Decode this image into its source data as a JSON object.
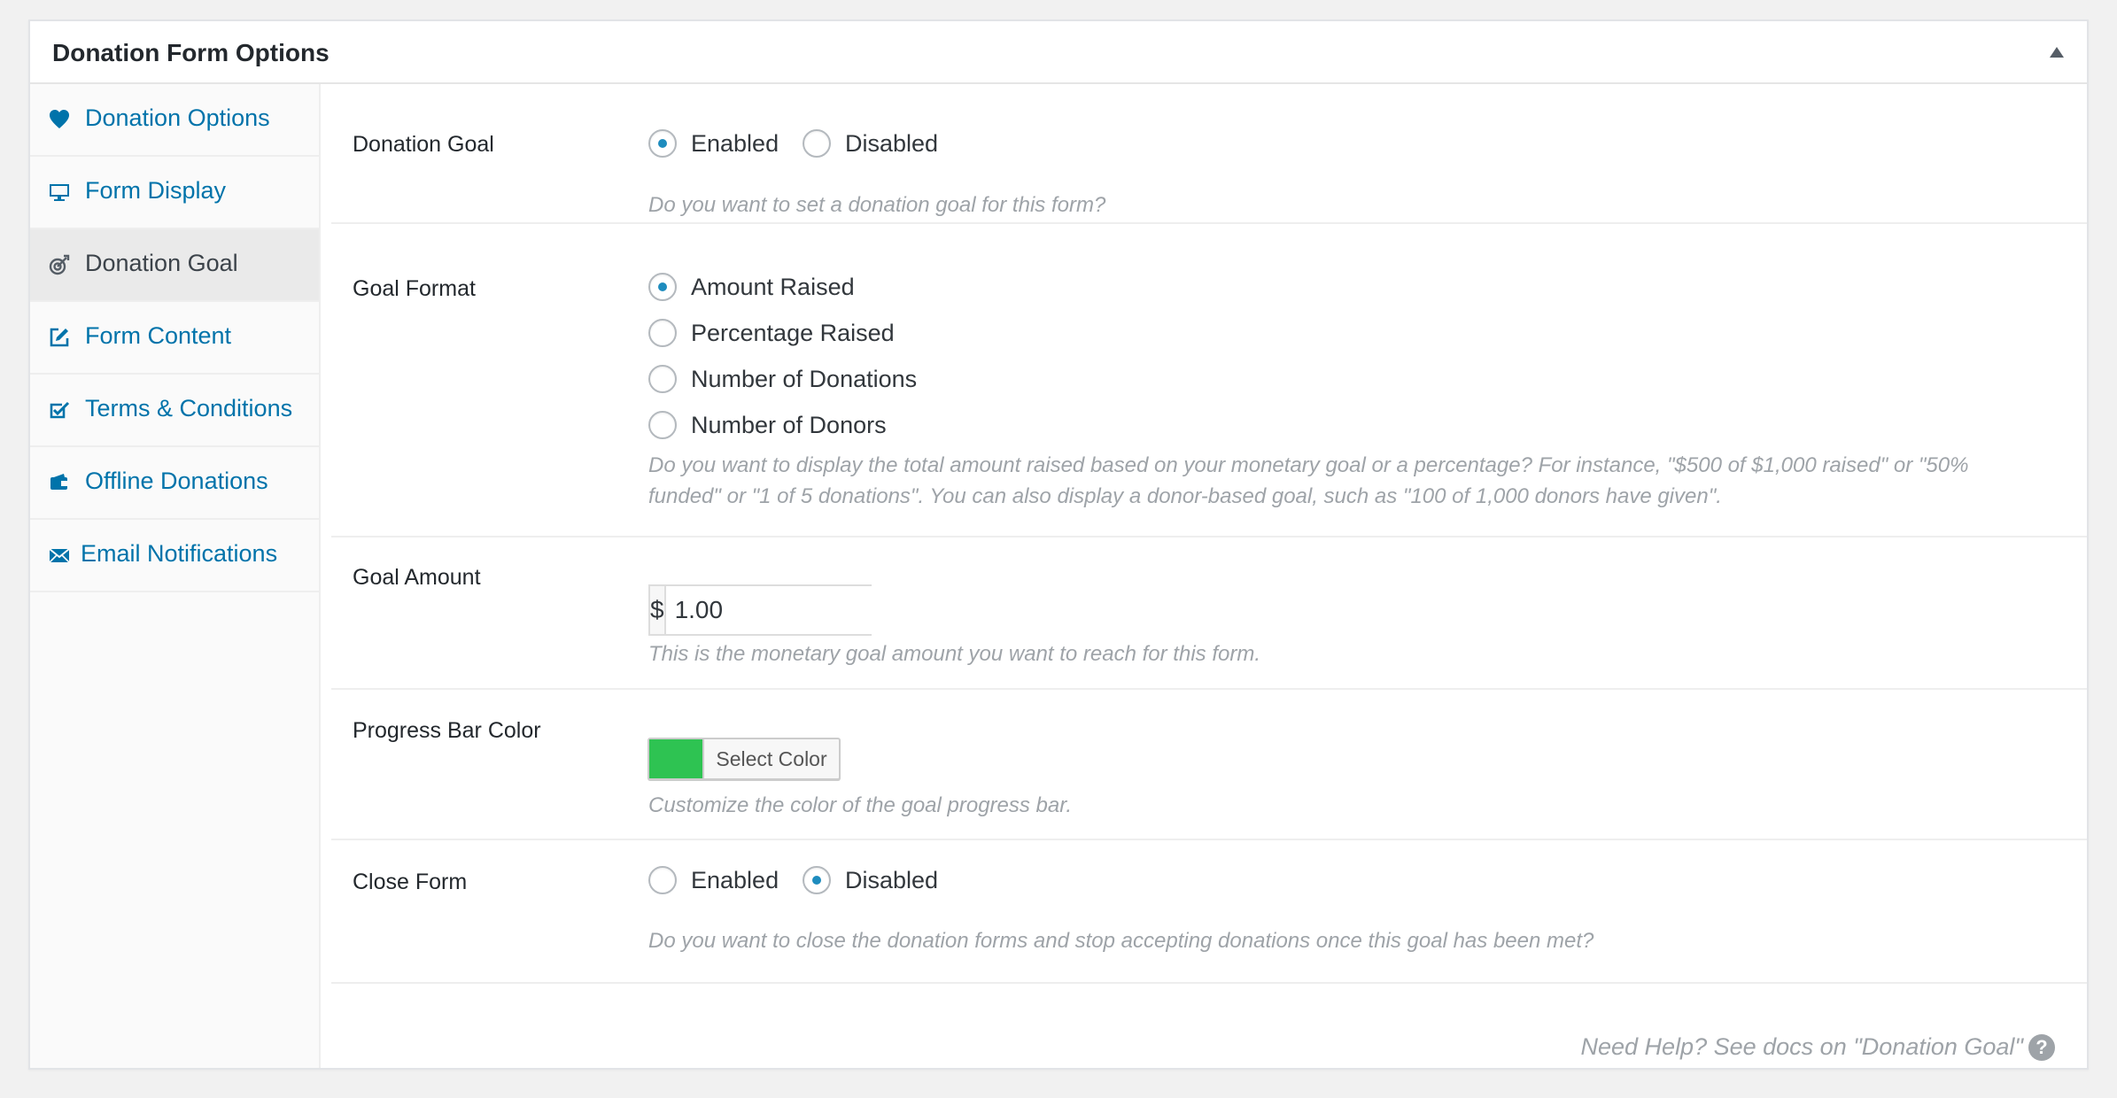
{
  "panel": {
    "title": "Donation Form Options"
  },
  "sidebar": {
    "items": [
      {
        "label": "Donation Options",
        "icon": "heart-icon"
      },
      {
        "label": "Form Display",
        "icon": "monitor-icon"
      },
      {
        "label": "Donation Goal",
        "icon": "target-icon",
        "active": true
      },
      {
        "label": "Form Content",
        "icon": "edit-icon"
      },
      {
        "label": "Terms & Conditions",
        "icon": "checkbox-icon"
      },
      {
        "label": "Offline Donations",
        "icon": "wallet-icon"
      },
      {
        "label": "Email Notifications",
        "icon": "envelope-icon"
      }
    ]
  },
  "fields": {
    "donation_goal": {
      "label": "Donation Goal",
      "options": [
        "Enabled",
        "Disabled"
      ],
      "selected": "Enabled",
      "description": "Do you want to set a donation goal for this form?"
    },
    "goal_format": {
      "label": "Goal Format",
      "options": [
        "Amount Raised",
        "Percentage Raised",
        "Number of Donations",
        "Number of Donors"
      ],
      "selected": "Amount Raised",
      "description_line1": "Do you want to display the total amount raised based on your monetary goal or a percentage? For instance, \"$500 of $1,000 raised\" or \"50%",
      "description_line2": "funded\" or \"1 of 5 donations\". You can also display a donor-based goal, such as \"100 of 1,000 donors have given\"."
    },
    "goal_amount": {
      "label": "Goal Amount",
      "currency": "$",
      "value": "1.00",
      "description": "This is the monetary goal amount you want to reach for this form."
    },
    "progress_bar_color": {
      "label": "Progress Bar Color",
      "button_label": "Select Color",
      "color": "#2ec352",
      "description": "Customize the color of the goal progress bar."
    },
    "close_form": {
      "label": "Close Form",
      "options": [
        "Enabled",
        "Disabled"
      ],
      "selected": "Disabled",
      "description": "Do you want to close the donation forms and stop accepting donations once this goal has been met?"
    }
  },
  "help": {
    "text": "Need Help? See docs on \"Donation Goal\"",
    "icon_glyph": "?"
  },
  "colors": {
    "link": "#0073aa",
    "radio_checked": "#1e8cbe",
    "description": "#9ea3a8"
  }
}
